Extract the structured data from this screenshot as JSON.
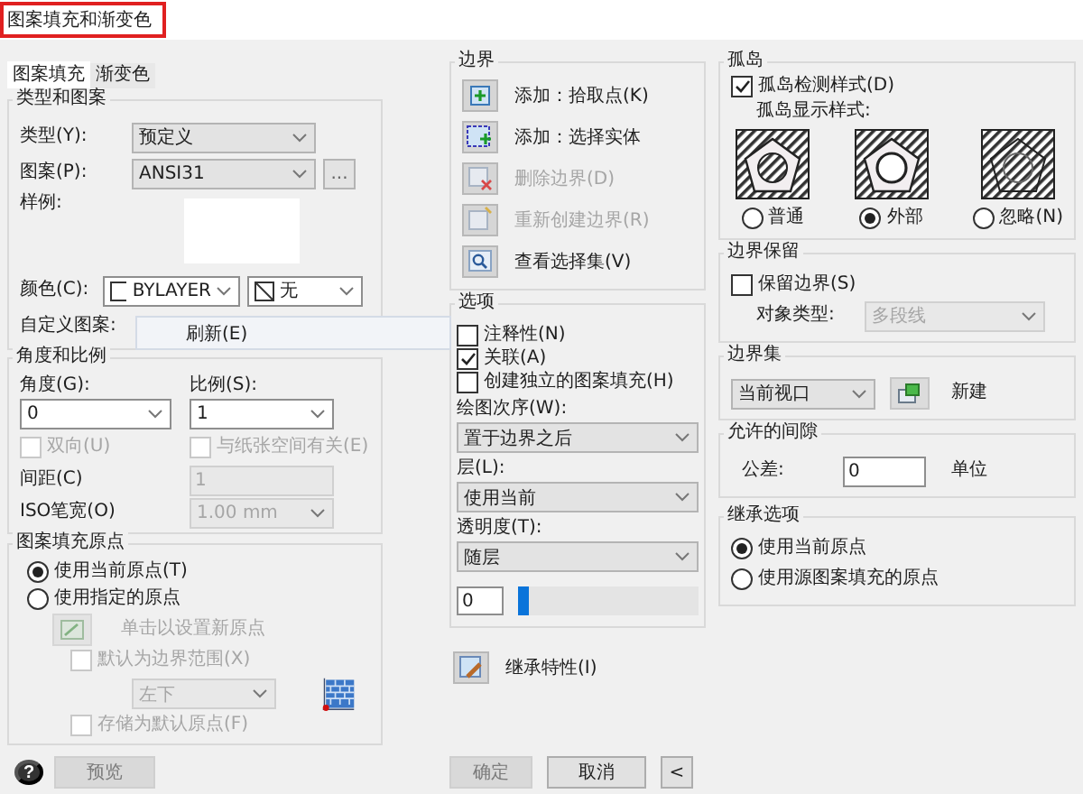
{
  "window": {
    "title": "图案填充和渐变色"
  },
  "tabs": [
    {
      "label": "图案填充",
      "selected": true
    },
    {
      "label": "渐变色",
      "selected": false
    }
  ],
  "type_and_pattern": {
    "title": "类型和图案",
    "type_label": "类型(Y):",
    "type_value": "预定义",
    "pattern_label": "图案(P):",
    "pattern_value": "ANSI31",
    "browse": "...",
    "sample_label": "样例:",
    "color_label": "颜色(C):",
    "color_value": "BYLAYER",
    "background_value": "无",
    "custom_label": "自定义图案:"
  },
  "context_menu": {
    "items": [
      {
        "label": "刷新(E)"
      }
    ]
  },
  "angle_and_scale": {
    "title": "角度和比例",
    "angle_label": "角度(G):",
    "angle_value": "0",
    "scale_label": "比例(S):",
    "scale_value": "1",
    "checks": [
      {
        "label": "双向(U)",
        "checked": false,
        "disabled": true
      },
      {
        "label": "与纸张空间有关(E)",
        "checked": false,
        "disabled": true
      }
    ],
    "spacing_label": "间距(C)",
    "spacing_value": "1",
    "iso_label": "ISO笔宽(O)",
    "iso_value": "1.00 mm",
    "disabled": true
  },
  "hatch_origin": {
    "title": "图案填充原点",
    "options": [
      {
        "label": "使用当前原点(T)",
        "selected": true
      },
      {
        "label": "使用指定的原点",
        "selected": false
      }
    ],
    "click_label": "单击以设置新原点",
    "checks": [
      {
        "label": "默认为边界范围(X)",
        "checked": false
      },
      {
        "label": "存储为默认原点(F)",
        "checked": false
      }
    ],
    "position_value": "左下",
    "disabled": true
  },
  "boundaries": {
    "title": "边界",
    "buttons": [
      {
        "kind": "pick",
        "label": "添加：拾取点(K)",
        "disabled": false
      },
      {
        "kind": "select",
        "label": "添加：选择实体",
        "disabled": false
      },
      {
        "kind": "remove",
        "label": "删除边界(D)",
        "disabled": true
      },
      {
        "kind": "recreate",
        "label": "重新创建边界(R)",
        "disabled": true
      },
      {
        "kind": "view",
        "label": "查看选择集(V)",
        "disabled": false
      }
    ]
  },
  "options": {
    "title": "选项",
    "checks": [
      {
        "label": "注释性(N)",
        "checked": false
      },
      {
        "label": "关联(A)",
        "checked": true
      },
      {
        "label": "创建独立的图案填充(H)",
        "checked": false
      }
    ],
    "draw_order_label": "绘图次序(W):",
    "draw_order_value": "置于边界之后",
    "layer_label": "层(L):",
    "layer_value": "使用当前",
    "transparency_label": "透明度(T):",
    "transparency_value": "随层",
    "transparency_amount": "0",
    "level": 0
  },
  "inherit_button": {
    "label": "继承特性(I)"
  },
  "islands": {
    "title": "孤岛",
    "detect": {
      "label": "孤岛检测样式(D)",
      "checked": true
    },
    "display_label": "孤岛显示样式:",
    "styles": [
      {
        "kind": "normal",
        "label": "普通",
        "selected": false
      },
      {
        "kind": "outer",
        "label": "外部",
        "selected": true
      },
      {
        "kind": "ignore",
        "label": "忽略(N)",
        "selected": false
      }
    ]
  },
  "boundary_retention": {
    "title": "边界保留",
    "retain": {
      "label": "保留边界(S)",
      "checked": false
    },
    "object_type_label": "对象类型:",
    "object_type_value": "多段线",
    "disabled": true
  },
  "boundary_set": {
    "title": "边界集",
    "value": "当前视口",
    "new_label": "新建"
  },
  "gap_tolerance": {
    "title": "允许的间隙",
    "label": "公差:",
    "value": "0",
    "unit": "单位"
  },
  "inherit_options": {
    "title": "继承选项",
    "options": [
      {
        "label": "使用当前原点",
        "selected": true
      },
      {
        "label": "使用源图案填充的原点",
        "selected": false
      }
    ]
  },
  "footer": {
    "help": "?",
    "preview": {
      "label": "预览",
      "disabled": true
    },
    "ok": {
      "label": "确定",
      "disabled": true
    },
    "cancel": {
      "label": "取消",
      "disabled": false
    },
    "more": "<"
  }
}
